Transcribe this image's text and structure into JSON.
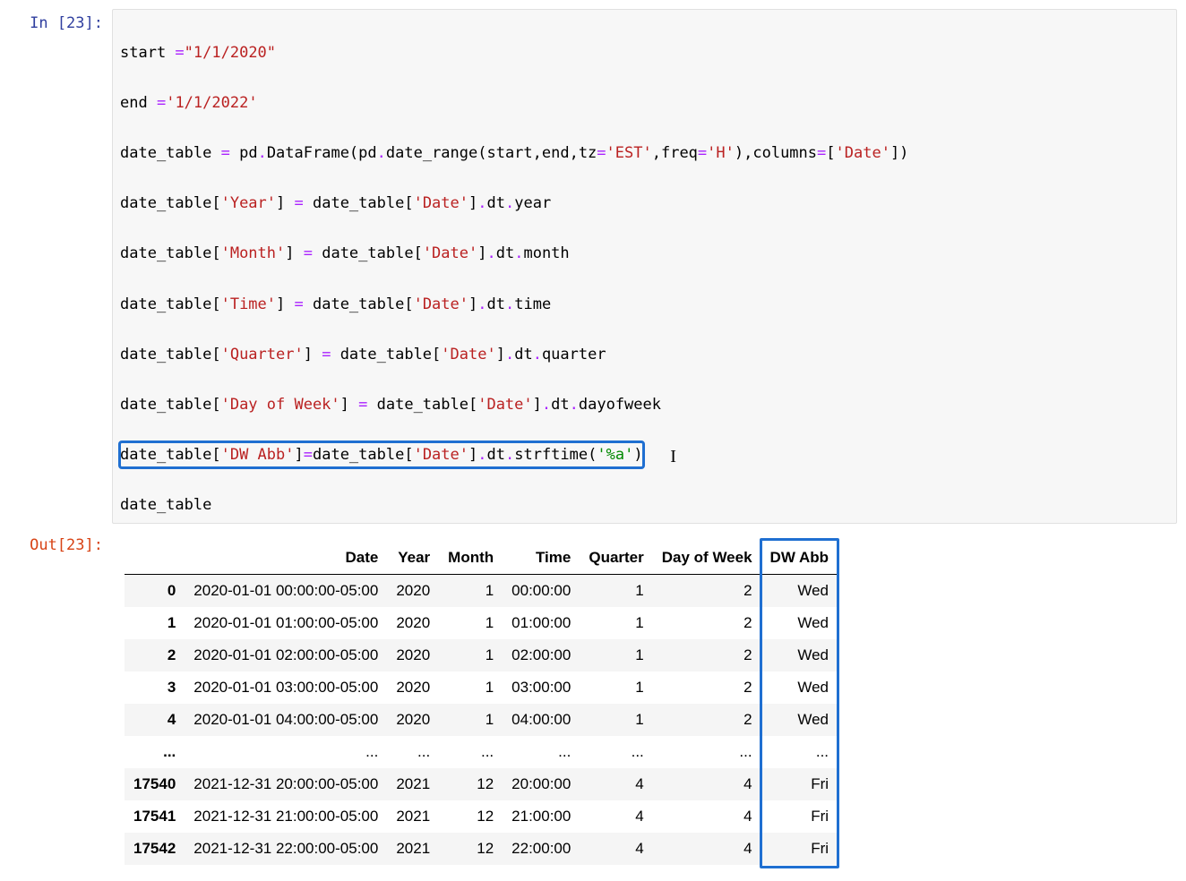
{
  "in_prompt": "In [23]:",
  "out_prompt": "Out[23]:",
  "code": {
    "l0_start": "start ",
    "l0_eq": "=",
    "l0_str": "\"1/1/2020\"",
    "l1_end_name": "end ",
    "l1_eq": "=",
    "l1_str": "'1/1/2022'",
    "l2_a": "date_table ",
    "l2_eq": "=",
    "l2_b": " pd",
    "l2_dot1": ".",
    "l2_c": "DataFrame(pd",
    "l2_dot2": ".",
    "l2_d": "date_range(start,end,tz",
    "l2_eq2": "=",
    "l2_s1": "'EST'",
    "l2_e": ",freq",
    "l2_eq3": "=",
    "l2_s2": "'H'",
    "l2_f": "),columns",
    "l2_eq4": "=",
    "l2_g": "[",
    "l2_s3": "'Date'",
    "l2_h": "])",
    "l3_a": "date_table[",
    "l3_s1": "'Year'",
    "l3_b": "] ",
    "l3_eq": "=",
    "l3_c": " date_table[",
    "l3_s2": "'Date'",
    "l3_d": "]",
    "l3_dot": ".",
    "l3_e": "dt",
    "l3_dot2": ".",
    "l3_f": "year",
    "l4_a": "date_table[",
    "l4_s1": "'Month'",
    "l4_b": "] ",
    "l4_eq": "=",
    "l4_c": " date_table[",
    "l4_s2": "'Date'",
    "l4_d": "]",
    "l4_dot": ".",
    "l4_e": "dt",
    "l4_dot2": ".",
    "l4_f": "month",
    "l5_a": "date_table[",
    "l5_s1": "'Time'",
    "l5_b": "] ",
    "l5_eq": "=",
    "l5_c": " date_table[",
    "l5_s2": "'Date'",
    "l5_d": "]",
    "l5_dot": ".",
    "l5_e": "dt",
    "l5_dot2": ".",
    "l5_f": "time",
    "l6_a": "date_table[",
    "l6_s1": "'Quarter'",
    "l6_b": "] ",
    "l6_eq": "=",
    "l6_c": " date_table[",
    "l6_s2": "'Date'",
    "l6_d": "]",
    "l6_dot": ".",
    "l6_e": "dt",
    "l6_dot2": ".",
    "l6_f": "quarter",
    "l7_a": "date_table[",
    "l7_s1": "'Day of Week'",
    "l7_b": "] ",
    "l7_eq": "=",
    "l7_c": " date_table[",
    "l7_s2": "'Date'",
    "l7_d": "]",
    "l7_dot": ".",
    "l7_e": "dt",
    "l7_dot2": ".",
    "l7_f": "dayofweek",
    "l8_a": "date_table[",
    "l8_s1": "'DW Abb'",
    "l8_b": "]",
    "l8_eq": "=",
    "l8_c": "date_table[",
    "l8_s2": "'Date'",
    "l8_d": "]",
    "l8_dot": ".",
    "l8_e": "dt",
    "l8_dot2": ".",
    "l8_f": "strftime(",
    "l8_s3": "'%a'",
    "l8_g": ")",
    "l9": "date_table"
  },
  "table": {
    "headers": [
      "",
      "Date",
      "Year",
      "Month",
      "Time",
      "Quarter",
      "Day of Week",
      "DW Abb"
    ],
    "rows": [
      {
        "idx": "0",
        "date": "2020-01-01 00:00:00-05:00",
        "year": "2020",
        "month": "1",
        "time": "00:00:00",
        "quarter": "1",
        "dow": "2",
        "dwabb": "Wed"
      },
      {
        "idx": "1",
        "date": "2020-01-01 01:00:00-05:00",
        "year": "2020",
        "month": "1",
        "time": "01:00:00",
        "quarter": "1",
        "dow": "2",
        "dwabb": "Wed"
      },
      {
        "idx": "2",
        "date": "2020-01-01 02:00:00-05:00",
        "year": "2020",
        "month": "1",
        "time": "02:00:00",
        "quarter": "1",
        "dow": "2",
        "dwabb": "Wed"
      },
      {
        "idx": "3",
        "date": "2020-01-01 03:00:00-05:00",
        "year": "2020",
        "month": "1",
        "time": "03:00:00",
        "quarter": "1",
        "dow": "2",
        "dwabb": "Wed"
      },
      {
        "idx": "4",
        "date": "2020-01-01 04:00:00-05:00",
        "year": "2020",
        "month": "1",
        "time": "04:00:00",
        "quarter": "1",
        "dow": "2",
        "dwabb": "Wed"
      },
      {
        "idx": "...",
        "date": "...",
        "year": "...",
        "month": "...",
        "time": "...",
        "quarter": "...",
        "dow": "...",
        "dwabb": "..."
      },
      {
        "idx": "17540",
        "date": "2021-12-31 20:00:00-05:00",
        "year": "2021",
        "month": "12",
        "time": "20:00:00",
        "quarter": "4",
        "dow": "4",
        "dwabb": "Fri"
      },
      {
        "idx": "17541",
        "date": "2021-12-31 21:00:00-05:00",
        "year": "2021",
        "month": "12",
        "time": "21:00:00",
        "quarter": "4",
        "dow": "4",
        "dwabb": "Fri"
      },
      {
        "idx": "17542",
        "date": "2021-12-31 22:00:00-05:00",
        "year": "2021",
        "month": "12",
        "time": "22:00:00",
        "quarter": "4",
        "dow": "4",
        "dwabb": "Fri"
      }
    ]
  }
}
